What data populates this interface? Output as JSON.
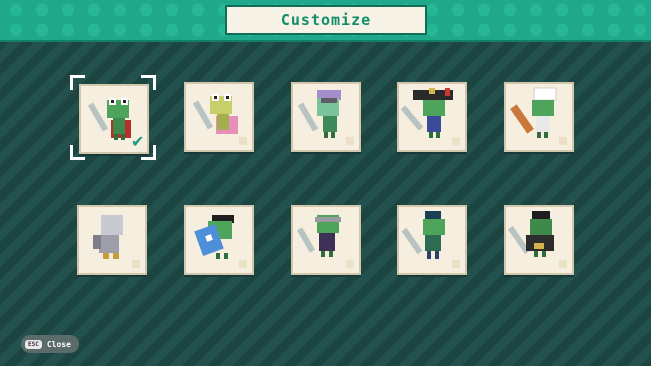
{
  "header": {
    "title": "Customize"
  },
  "footer": {
    "key": "ESC",
    "action": "Close"
  },
  "colors": {
    "accent": "#1fa98a",
    "card": "#f6efdf",
    "background": "#214d4a",
    "checkmark": "#1a9c80"
  },
  "selected_index": 0,
  "costumes": [
    {
      "name": "red-cape-frog",
      "icon": "frog-red-cape-sword"
    },
    {
      "name": "pink-cape-frog",
      "icon": "frog-pink-cape-sword"
    },
    {
      "name": "purple-hair-frog",
      "icon": "frog-purple-hair-sword"
    },
    {
      "name": "pirate-frog",
      "icon": "frog-pirate-hat-sword"
    },
    {
      "name": "chef-frog",
      "icon": "frog-chef-rolling-pin"
    },
    {
      "name": "knight-frog",
      "icon": "frog-armor-helmet"
    },
    {
      "name": "shield-frog",
      "icon": "frog-shades-shield"
    },
    {
      "name": "ninja-frog",
      "icon": "frog-ninja-headband-sword"
    },
    {
      "name": "spiky-hair-frog",
      "icon": "frog-spiky-hair-sword"
    },
    {
      "name": "dark-warrior-frog",
      "icon": "frog-dark-horned-sword"
    }
  ]
}
